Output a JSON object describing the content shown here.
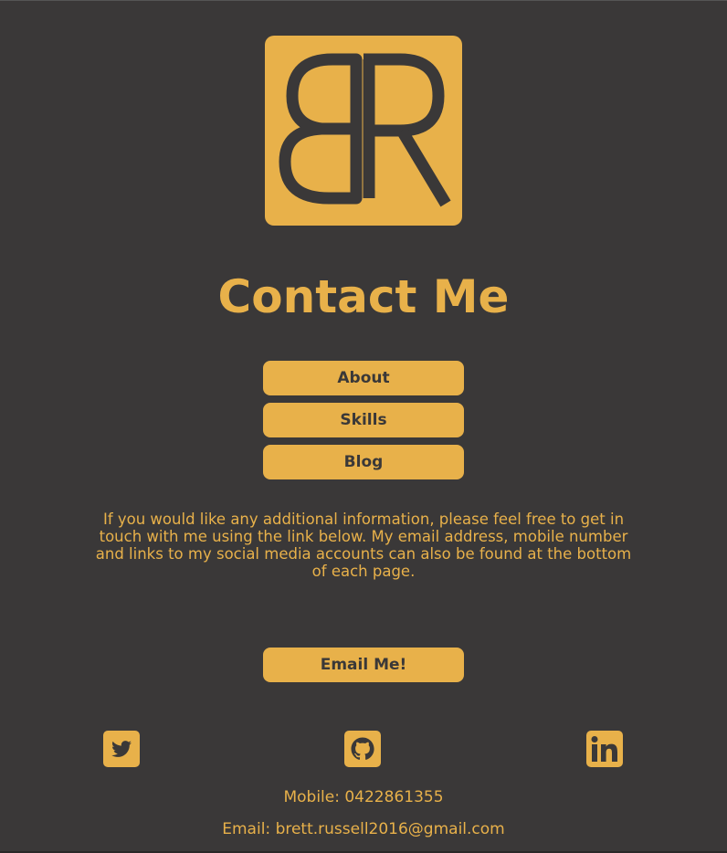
{
  "page": {
    "title": "Contact Me",
    "background": "#3a3838",
    "accent": "#e8b14a"
  },
  "logo": {
    "letters": "BR",
    "style": "mirrored-B-R-monogram"
  },
  "nav": {
    "items": [
      {
        "label": "About"
      },
      {
        "label": "Skills"
      },
      {
        "label": "Blog"
      }
    ]
  },
  "intro": {
    "text": "If you would like any additional information, please feel free to get in touch with me using the link below. My email address, mobile number and links to my social media accounts can also be found at the bottom of each page."
  },
  "cta": {
    "email_label": "Email Me!"
  },
  "social": {
    "icons": [
      "twitter-icon",
      "github-icon",
      "linkedin-icon"
    ]
  },
  "footer": {
    "mobile_label": "Mobile:",
    "mobile": "0422861355",
    "email_label": "Email:",
    "email": "brett.russell2016@gmail.com"
  }
}
